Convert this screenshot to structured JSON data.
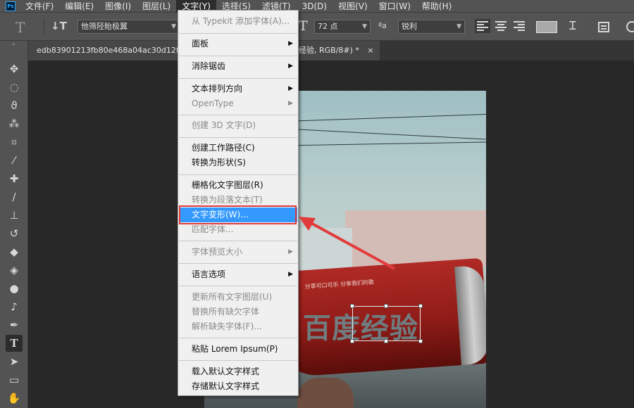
{
  "menubar": {
    "logo": "Ps",
    "items": [
      "文件(F)",
      "编辑(E)",
      "图像(I)",
      "图层(L)",
      "文字(Y)",
      "选择(S)",
      "滤镜(T)",
      "3D(D)",
      "视图(V)",
      "窗口(W)",
      "帮助(H)"
    ]
  },
  "options": {
    "font_family": "忚筛陉貽极翼",
    "font_size": "72 点",
    "antialias_label": "ªa",
    "antialias": "锐利"
  },
  "document": {
    "tab_start": "edb83901213fb80e468a04ac30d12f",
    "tab_end": "经验, RGB/8#) *",
    "close": "×"
  },
  "photo": {
    "overlay_text": "百度经验",
    "can_slogan": "分享可口可乐   分享我们的歌"
  },
  "type_menu": {
    "items": [
      {
        "label": "从 Typekit 添加字体(A)...",
        "disabled": true
      },
      {
        "label": "面板",
        "submenu": true
      },
      {
        "label": "消除锯齿",
        "submenu": true
      },
      {
        "label": "文本排列方向",
        "submenu": true
      },
      {
        "label": "OpenType",
        "submenu": true,
        "disabled": true
      },
      {
        "label": "创建 3D 文字(D)",
        "disabled": true
      },
      {
        "label": "创建工作路径(C)"
      },
      {
        "label": "转换为形状(S)"
      },
      {
        "label": "栅格化文字图层(R)"
      },
      {
        "label": "转换为段落文本(T)",
        "disabled": true
      },
      {
        "label": "文字变形(W)...",
        "selected": true
      },
      {
        "label": "匹配字体...",
        "disabled": true
      },
      {
        "label": "字体预览大小",
        "submenu": true,
        "disabled": true
      },
      {
        "label": "语言选项",
        "submenu": true
      },
      {
        "label": "更新所有文字图层(U)",
        "disabled": true
      },
      {
        "label": "替换所有缺欠字体",
        "disabled": true
      },
      {
        "label": "解析缺失字体(F)...",
        "disabled": true
      },
      {
        "label": "粘贴 Lorem Ipsum(P)"
      },
      {
        "label": "载入默认文字样式"
      },
      {
        "label": "存储默认文字样式"
      }
    ],
    "submenu_arrow": "▶"
  },
  "colors": {
    "accent_selected": "#3399ff",
    "highlight_box": "#e23b3b",
    "annotation_arrow": "#e23b3b"
  }
}
